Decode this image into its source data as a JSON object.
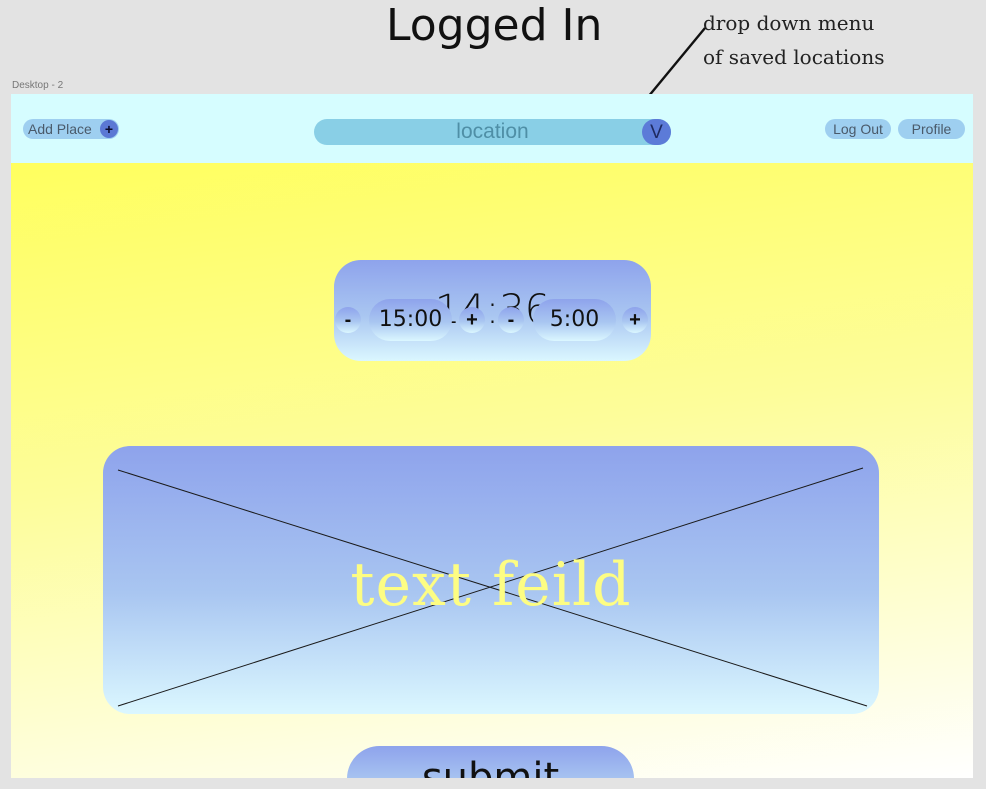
{
  "annotation": {
    "heading": "Logged In",
    "note_line1": "drop down menu",
    "note_line2": "of saved locations"
  },
  "frame": {
    "label": "Desktop - 2"
  },
  "topbar": {
    "add_place": "Add Place",
    "add_place_icon": "+",
    "location_placeholder": "location",
    "location_dropdown_icon": "V",
    "logout": "Log Out",
    "profile": "Profile"
  },
  "timer": {
    "display": "14:36",
    "work_minus": "-",
    "work_value": "15:00",
    "work_plus": "+",
    "break_minus": "-",
    "break_value": "5:00",
    "break_plus": "+"
  },
  "textbox": {
    "label": "text feild"
  },
  "submit": {
    "label": "submit"
  },
  "colors": {
    "topbar_bg": "#d6fdff",
    "accent_blue": "#5c7bd8",
    "pill_blue": "#9ecff0",
    "yellow_bg": "#ffff5e"
  },
  "icons": {
    "add": "plus-icon",
    "dropdown": "chevron-down-icon",
    "arrow": "arrow-annotation"
  }
}
